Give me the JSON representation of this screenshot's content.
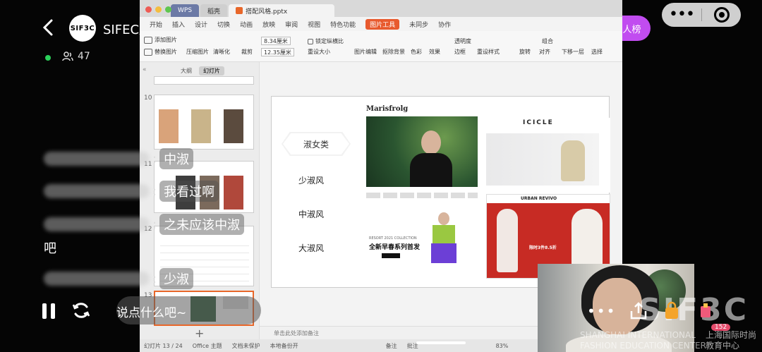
{
  "header": {
    "back_icon": "back-arrow-icon",
    "avatar_text": "SIF3C",
    "room_title": "SIFEC服装美学...",
    "viewer_count": "47",
    "invite_label": "邀请达人榜",
    "capsule_more": "•••"
  },
  "screen": {
    "tabs": [
      "WPS",
      "稻壳",
      "搭配风格.pptx"
    ],
    "menu": [
      "开始",
      "插入",
      "设计",
      "切换",
      "动画",
      "放映",
      "审阅",
      "视图",
      "特色功能",
      "图片工具",
      "未同步",
      "协作"
    ],
    "toolbar": {
      "add_image": "添加图片",
      "replace_image": "替换图片",
      "compress": "压缩图片",
      "sharpen": "清晰化",
      "crop": "裁剪",
      "height": "8.34厘米",
      "width": "12.35厘米",
      "lock_ratio": "锁定纵横比",
      "reset_size": "重设大小",
      "edit": "图片编辑",
      "remove_bg": "抠除背景",
      "color": "色彩",
      "effect": "效果",
      "transparent": "透明度",
      "border": "边框",
      "reset_style": "重设样式",
      "rotate": "旋转",
      "align": "对齐",
      "combine": "组合",
      "down_layer": "下移一层",
      "select": "选择"
    },
    "panel_tabs": [
      "大纲",
      "幻灯片"
    ],
    "slide_numbers": [
      "10",
      "11",
      "12",
      "13"
    ],
    "notes_placeholder": "单击此处添加备注",
    "status": {
      "slide_pos": "幻灯片 13 / 24",
      "theme": "Office 主题",
      "protect": "文档未保护",
      "backup": "本地备份开",
      "notes": "备注",
      "comments": "批注",
      "zoom": "83%"
    }
  },
  "slide": {
    "selected_category": "淑女类",
    "categories": [
      "少淑风",
      "中淑风",
      "大淑风"
    ],
    "brands": [
      "Marisfrolg",
      "ICICLE",
      "URBAN REVIVO"
    ],
    "promo_small": "RESORT 2021 COLLECTION",
    "promo_headline": "全新早春系列首发",
    "ur_promo": "限时3件8.5折"
  },
  "chat": [
    {
      "message": "中淑"
    },
    {
      "message": "我看过啊"
    },
    {
      "message": "之未应该中淑"
    },
    {
      "message": "吧"
    },
    {
      "message": "少淑"
    }
  ],
  "controls": {
    "say_placeholder": "说点什么吧~",
    "like_count": "152"
  },
  "watermark": {
    "logo": "SIF3C",
    "english": "SHANGHAI INTERNATIONAL FASHION EDUCATION CENTER",
    "english_line1": "SHANGHAI INTERNATIONAL",
    "english_line2": "FASHION EDUCATION CENTER",
    "chinese": "上海国际时尚教育中心",
    "chinese_line1": "上海国际时尚",
    "chinese_line2": "教育中心"
  },
  "colors": {
    "accent_orange": "#e8672a",
    "invite_purple": "#c14cf0",
    "online_green": "#2bd05a"
  }
}
